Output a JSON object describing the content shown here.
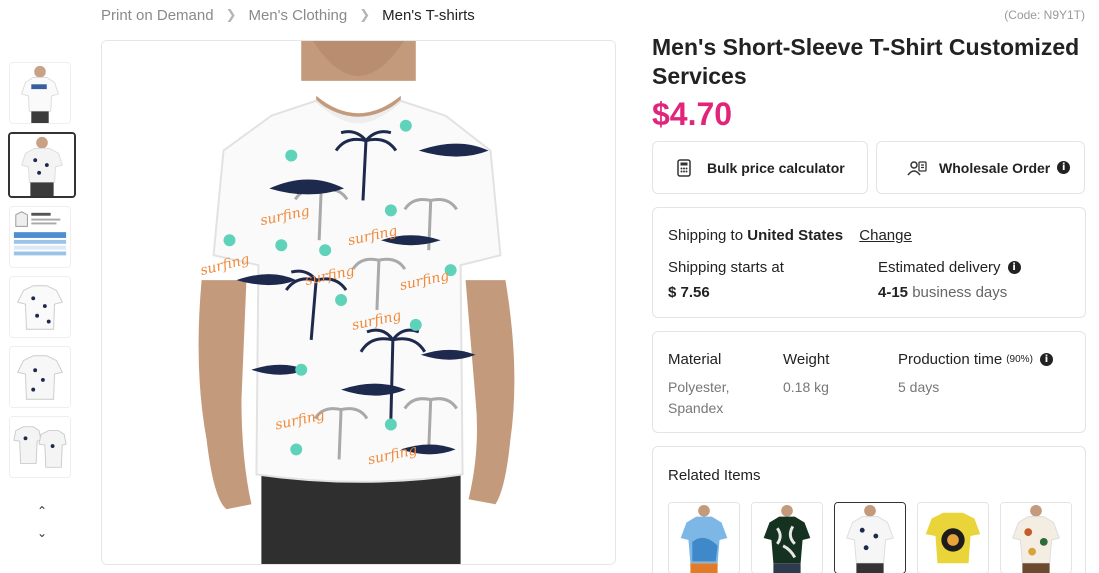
{
  "breadcrumb": {
    "items": [
      "Print on Demand",
      "Men's Clothing"
    ],
    "current": "Men's T-shirts"
  },
  "product": {
    "code": "(Code: N9Y1T)",
    "title": "Men's Short-Sleeve T-Shirt Customized Services",
    "price": "$4.70",
    "price_color": "#e0257a",
    "image_pattern_text": "surfing"
  },
  "actions": {
    "bulk_label": "Bulk price calculator",
    "bulk_icon": "calculator-icon",
    "wholesale_label": "Wholesale Order",
    "wholesale_icon": "users-icon"
  },
  "shipping": {
    "prefix": "Shipping to",
    "country": "United States",
    "change_label": "Change",
    "starts_label": "Shipping starts at",
    "starts_value": "$ 7.56",
    "estimated_label": "Estimated delivery",
    "estimated_range": "4-15",
    "estimated_unit": "business days"
  },
  "specs": {
    "material_label": "Material",
    "material_value": "Polyester, Spandex",
    "weight_label": "Weight",
    "weight_value": "0.18 kg",
    "production_label": "Production time",
    "production_pct": "(90%)",
    "production_value": "5 days"
  },
  "related": {
    "title": "Related Items",
    "count": 5
  }
}
